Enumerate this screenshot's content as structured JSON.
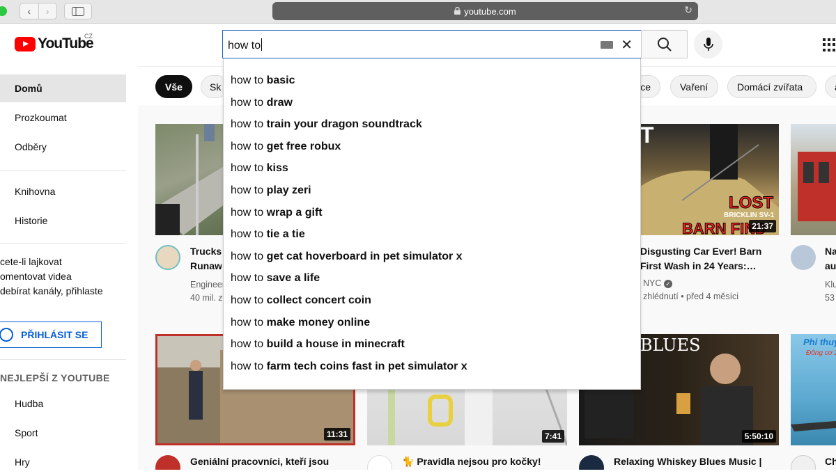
{
  "browser": {
    "url": "youtube.com"
  },
  "header": {
    "logo_text": "YouTube",
    "country_code": "CZ",
    "search_query": "how to"
  },
  "sidebar": {
    "items": [
      {
        "label": "Domů"
      },
      {
        "label": "Prozkoumat"
      },
      {
        "label": "Odběry"
      },
      {
        "label": "Knihovna"
      },
      {
        "label": "Historie"
      }
    ],
    "signin_prompt": "cete-li lajkovat\nomentovat videa\ndebírat kanály, přihlaste",
    "signin_button": "PŘIHLÁSIT SE",
    "section_heading": "NEJLEPŠÍ Z YOUTUBE",
    "best_of": [
      {
        "label": "Hudba"
      },
      {
        "label": "Sport"
      },
      {
        "label": "Hry"
      }
    ]
  },
  "chips": [
    {
      "label": "Vše"
    },
    {
      "label": "Sk"
    },
    {
      "label": "ce"
    },
    {
      "label": "Vaření"
    },
    {
      "label": "Domácí zvířata"
    },
    {
      "label": "a"
    }
  ],
  "suggestions": [
    {
      "prefix": "how to",
      "rest": "basic"
    },
    {
      "prefix": "how to",
      "rest": "draw"
    },
    {
      "prefix": "how to",
      "rest": "train your dragon soundtrack"
    },
    {
      "prefix": "how to",
      "rest": "get free robux"
    },
    {
      "prefix": "how to",
      "rest": "kiss"
    },
    {
      "prefix": "how to",
      "rest": "play zeri"
    },
    {
      "prefix": "how to",
      "rest": "wrap a gift"
    },
    {
      "prefix": "how to",
      "rest": "tie a tie"
    },
    {
      "prefix": "how to",
      "rest": "get cat hoverboard in pet simulator x"
    },
    {
      "prefix": "how to",
      "rest": "save a life"
    },
    {
      "prefix": "how to",
      "rest": "collect concert coin"
    },
    {
      "prefix": "how to",
      "rest": "make money online"
    },
    {
      "prefix": "how to",
      "rest": "build a house in minecraft"
    },
    {
      "prefix": "how to",
      "rest": "farm tech coins fast in pet simulator x"
    }
  ],
  "videos": [
    {
      "title": "Trucks\nRunaw",
      "channel": "Engineer",
      "stats": "40 mil. z"
    },
    {
      "title": "Disgusting Car Ever! Barn\nFirst Wash in 24 Years:…",
      "channel": "NYC",
      "stats": "zhlédnutí • před 4 měsíci",
      "duration": "21:37",
      "thumb_text_big": "LOST",
      "thumb_text_small": "BRICKLIN SV-1",
      "thumb_text_bottom": "BARN FIND",
      "thumb_text_top": "T"
    },
    {
      "title": "Na\nau",
      "channel": "Klu",
      "stats": "53"
    },
    {
      "title": "Geniální pracovníci, kteří jsou",
      "duration": "11:31"
    },
    {
      "title": "🐈 Pravidla nejsou pro kočky!",
      "duration": "7:41"
    },
    {
      "title": "Relaxing Whiskey Blues Music |",
      "duration": "5:50:10",
      "thumb_text": "BLUES"
    },
    {
      "title": "Ch",
      "thumb_text": "Phi thuy",
      "thumb_text2": "Đông cơ 2"
    }
  ]
}
